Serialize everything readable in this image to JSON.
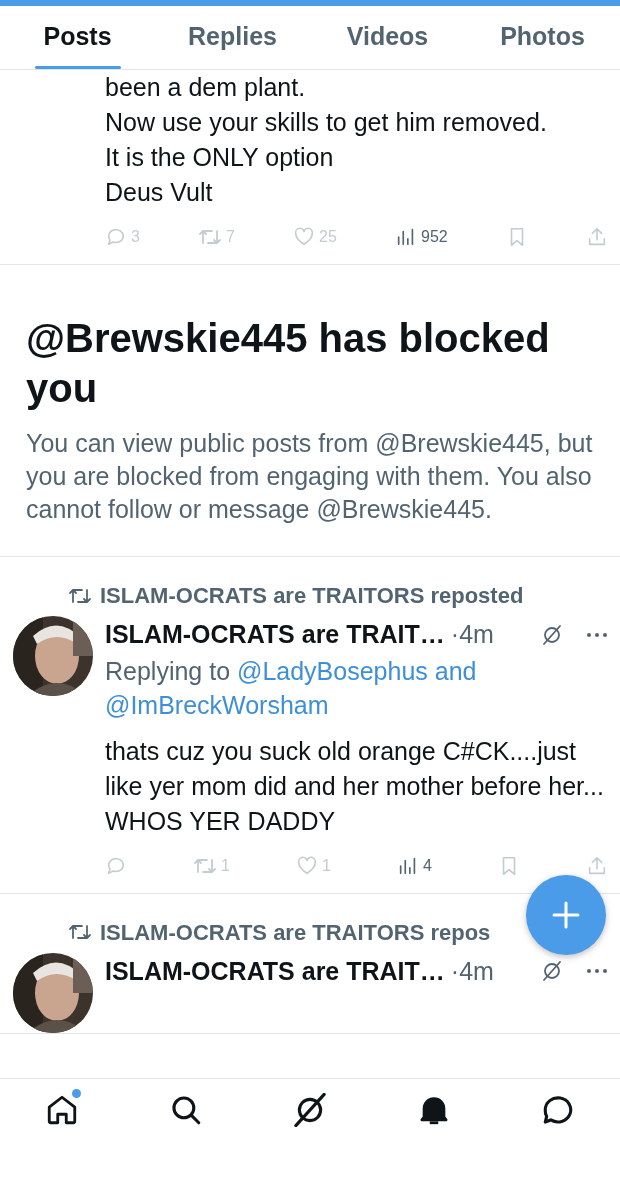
{
  "tabs": [
    {
      "label": "Posts",
      "selected": true
    },
    {
      "label": "Replies",
      "selected": false
    },
    {
      "label": "Videos",
      "selected": false
    },
    {
      "label": "Photos",
      "selected": false
    }
  ],
  "feed": [
    {
      "kind": "post",
      "text": "been a dem plant.\nNow use your skills to get him removed.\nIt is the ONLY option\nDeus Vult",
      "actions": {
        "reply": "3",
        "repost": "7",
        "like": "25",
        "views": "952"
      }
    },
    {
      "kind": "notice",
      "title": "@Brewskie445 has blocked you",
      "body": "You can view public posts from @Brewskie445, but you are blocked from engaging with them. You also cannot follow or message @Brewskie445."
    },
    {
      "kind": "post",
      "repost_label": "ISLAM-OCRATS are TRAITORS reposted",
      "author": "ISLAM-OCRATS are TRAIT…",
      "time": "·4m",
      "replying_prefix": "Replying to",
      "replying_to": [
        "@LadyBosephus and",
        "@ImBreckWorsham"
      ],
      "text": "thats cuz you suck old orange C#CK....just like yer mom did and her mother before her...\nWHOS YER DADDY",
      "actions": {
        "repost": "1",
        "like": "1",
        "views": "4"
      }
    },
    {
      "kind": "post",
      "repost_label": "ISLAM-OCRATS are TRAITORS repos",
      "author": "ISLAM-OCRATS are TRAIT…",
      "time": "·4m"
    }
  ],
  "nav": [
    {
      "kind": "home",
      "dot": true
    },
    {
      "kind": "search",
      "dot": false
    },
    {
      "kind": "slash",
      "dot": false
    },
    {
      "kind": "bell",
      "dot": false
    },
    {
      "kind": "chat",
      "dot": false
    }
  ]
}
